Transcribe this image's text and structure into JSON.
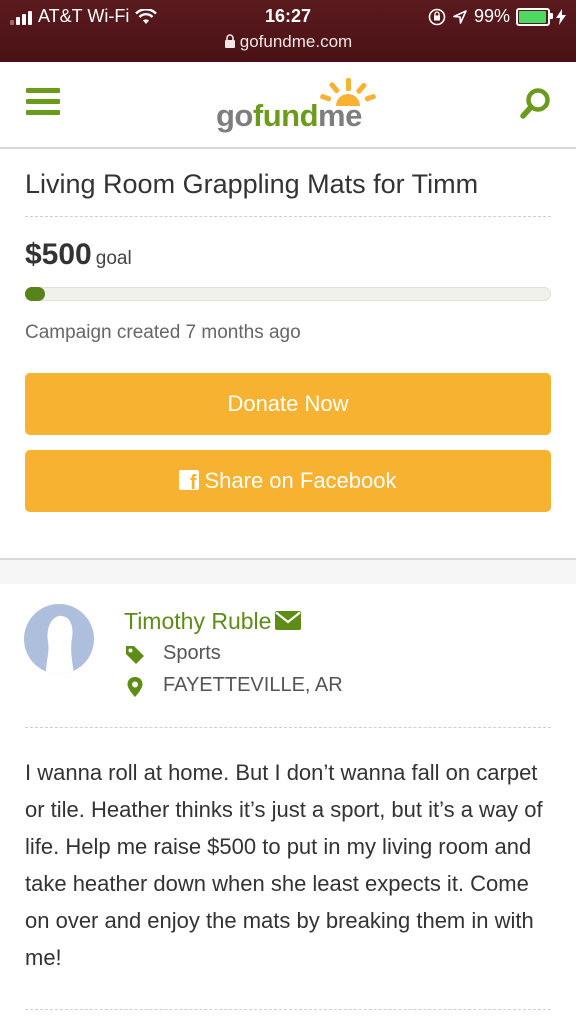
{
  "status_bar": {
    "carrier": "AT&T Wi-Fi",
    "time": "16:27",
    "battery": "99%",
    "battery_level": 0.99,
    "url": "gofundme.com"
  },
  "header": {
    "logo": {
      "part1": "go",
      "part2": "fund",
      "part3": "me"
    },
    "icons": {
      "menu": "hamburger-menu-icon",
      "search": "search-icon",
      "logo_sun": "sun-icon"
    }
  },
  "campaign": {
    "title": "Living Room Grappling Mats for Timm",
    "goal_amount": "$500",
    "goal_label": "goal",
    "progress_fraction": 0.02,
    "created": "Campaign created 7 months ago",
    "donate_label": "Donate Now",
    "share_label": "Share on Facebook"
  },
  "organizer": {
    "name": "Timothy Ruble",
    "category": "Sports",
    "location": "FAYETTEVILLE, AR"
  },
  "story": "I wanna roll at home. But I don’t wanna fall on carpet or tile. Heather thinks it’s just a sport, but it’s a way of life. Help me raise $500 to put in my living room and take heather down when she least expects it. Come on over and enjoy the mats by breaking them in with me!",
  "colors": {
    "brand_green": "#6a9b1c",
    "button_orange": "#f6b230",
    "status_bar": "#4a1216"
  }
}
